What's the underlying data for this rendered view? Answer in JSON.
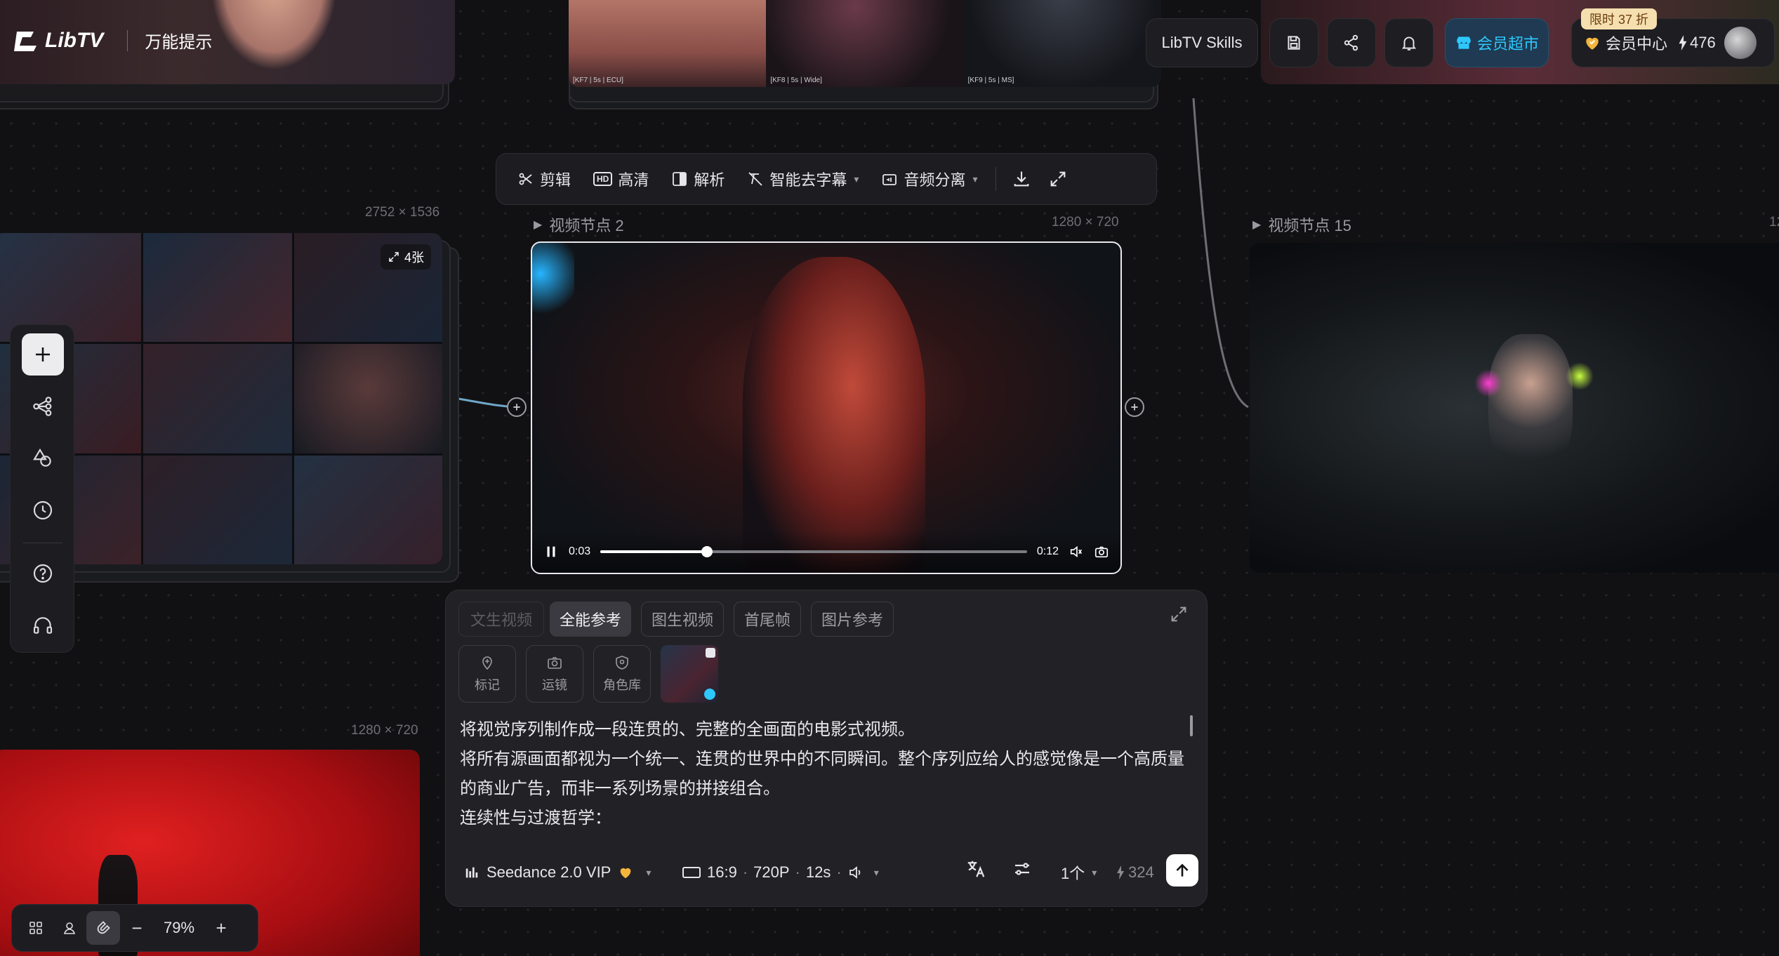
{
  "brand": {
    "logo_text": "LibTV",
    "page_title": "万能提示"
  },
  "thumbs": {
    "kf7": "[KF7 | 5s | ECU]",
    "kf8": "[KF8 | 5s | Wide]",
    "kf9": "[KF9 | 5s | MS]"
  },
  "header": {
    "skills_label": "LibTV Skills",
    "vip_market_label": "会员超市",
    "promo_badge": "限时 37 折",
    "member_center_label": "会员中心",
    "credits": "476"
  },
  "toolbar": {
    "cut": "剪辑",
    "hd": "高清",
    "hd_badge": "HD",
    "analyze": "解析",
    "smart_subtitle": "智能去字幕",
    "audio_split": "音频分离"
  },
  "nodes": {
    "image_group": {
      "dims": "2752 × 1536",
      "count": "4张"
    },
    "video2": {
      "title": "视频节点 2",
      "dims": "1280 × 720",
      "current_time": "0:03",
      "duration": "0:12",
      "progress": 0.25
    },
    "video15": {
      "title": "视频节点 15",
      "dims": "12"
    },
    "red_image": {
      "dims": "1280 × 720"
    }
  },
  "panel": {
    "tabs": [
      "文生视频",
      "全能参考",
      "图生视频",
      "首尾帧",
      "图片参考"
    ],
    "active_tab": "全能参考",
    "tools": {
      "mark": "标记",
      "camera": "运镜",
      "characters": "角色库"
    },
    "prompt_lines": [
      "将视觉序列制作成一段连贯的、完整的全画面的电影式视频。",
      "将所有源画面都视为一个统一、连贯的世界中的不同瞬间。整个序列应给人的感觉像是一个高质量",
      "的商业广告，而非一系列场景的拼接组合。",
      "连续性与过渡哲学："
    ],
    "model": "Seedance 2.0 VIP",
    "aspect": "16:9",
    "resolution": "720P",
    "duration": "12s",
    "count": "1个",
    "cost": "324"
  },
  "zoom": {
    "level": "79%"
  },
  "colors": {
    "accent": "#2ec8ff",
    "gold": "#f5b53c",
    "market_bg": "#1f3f57"
  }
}
